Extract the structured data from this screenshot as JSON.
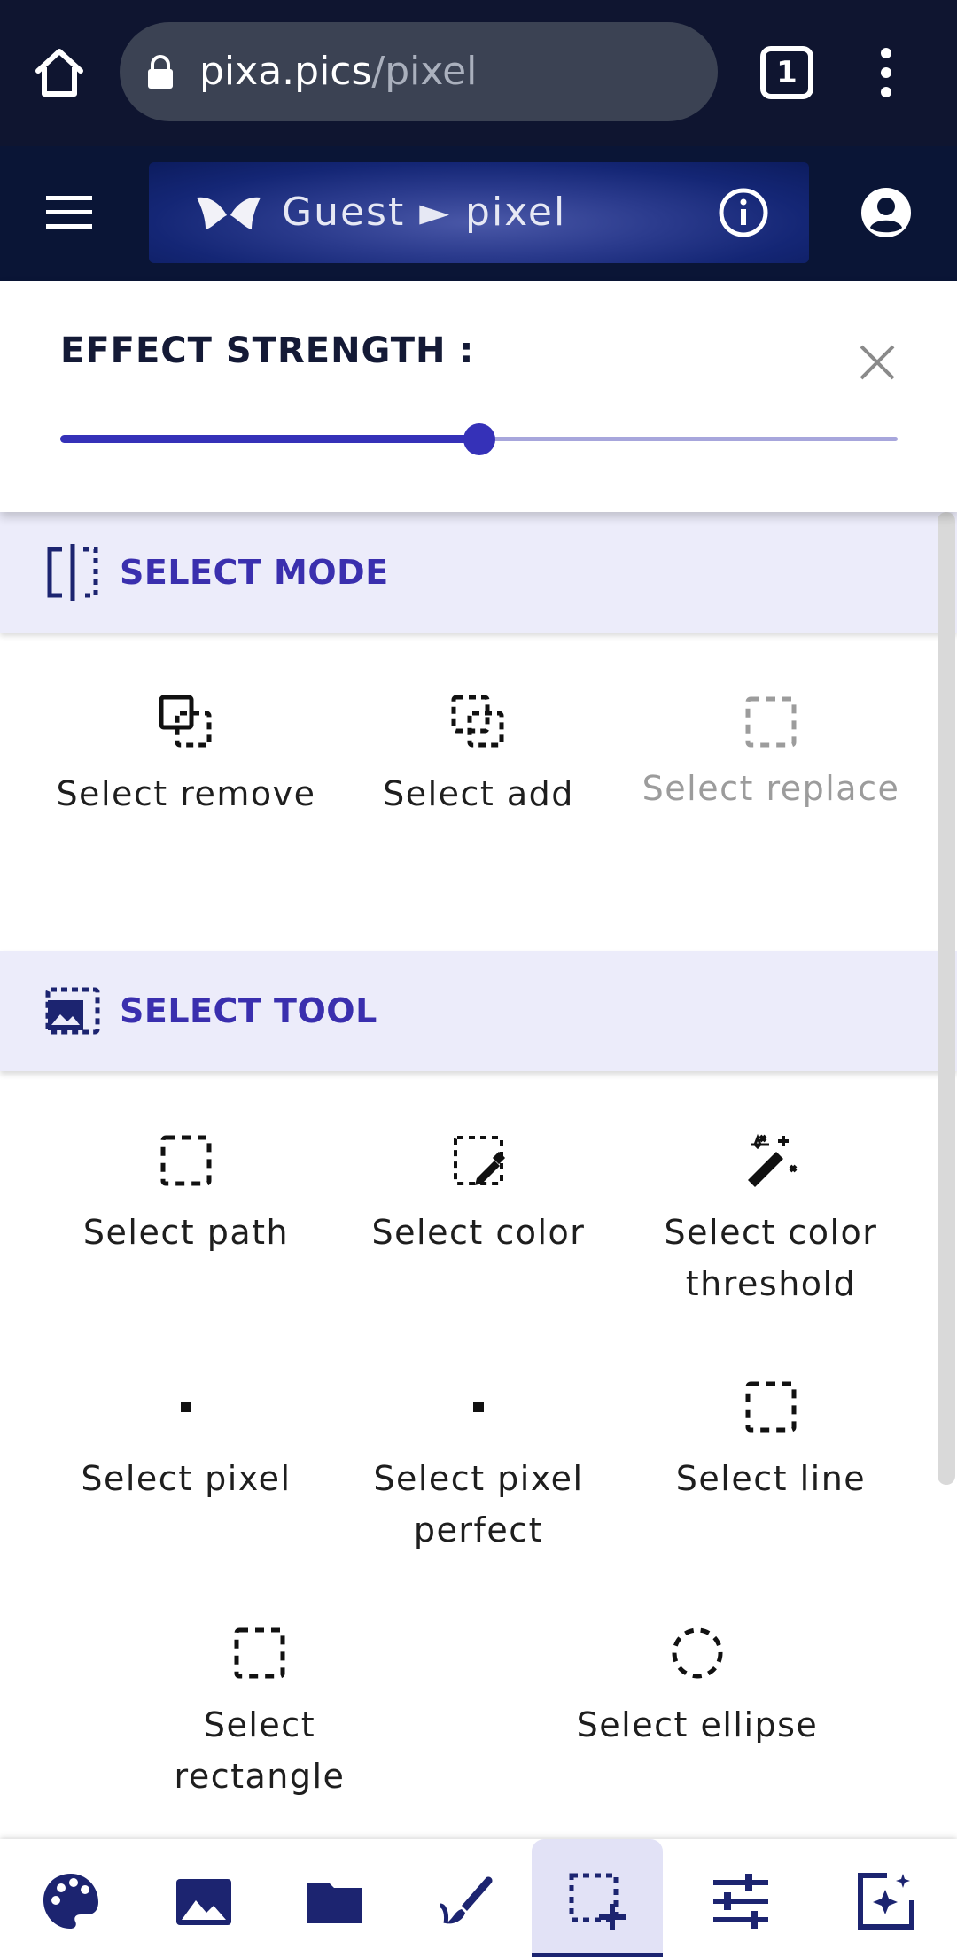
{
  "browser": {
    "url_domain": "pixa.pics",
    "url_path": "/pixel",
    "tab_count": "1"
  },
  "app_header": {
    "title": "Guest ► pixel"
  },
  "effect_panel": {
    "title": "EFFECT STRENGTH :",
    "strength_fraction": 0.5
  },
  "select_mode": {
    "title": "SELECT MODE",
    "items": [
      {
        "label": "Select remove",
        "icon": "select-remove-icon",
        "enabled": true
      },
      {
        "label": "Select add",
        "icon": "select-add-icon",
        "enabled": true
      },
      {
        "label": "Select replace",
        "icon": "select-replace-icon",
        "enabled": false
      }
    ]
  },
  "select_tool": {
    "title": "SELECT TOOL",
    "items": [
      {
        "label": "Select path",
        "icon": "select-path-icon"
      },
      {
        "label": "Select color",
        "icon": "select-color-icon"
      },
      {
        "label": "Select color threshold",
        "icon": "magic-wand-icon"
      },
      {
        "label": "Select pixel",
        "icon": "select-pixel-icon"
      },
      {
        "label": "Select pixel perfect",
        "icon": "select-pixel-perfect-icon"
      },
      {
        "label": "Select line",
        "icon": "select-line-icon"
      },
      {
        "label": "Select rectangle",
        "icon": "select-rectangle-icon"
      },
      {
        "label": "Select ellipse",
        "icon": "select-ellipse-icon"
      }
    ]
  },
  "bottom_nav": {
    "items": [
      "palette-icon",
      "image-icon",
      "folder-icon",
      "brush-icon",
      "selection-add-icon",
      "tune-icon",
      "filter-icon"
    ],
    "active": "selection-add-icon"
  },
  "colors": {
    "browser_bg": "#0f1530",
    "header_bg": "#0a1536",
    "accent": "#3531b8",
    "section_title": "#3a2fae",
    "section_bg": "#ececfa",
    "nav_icon": "#1c2470"
  }
}
